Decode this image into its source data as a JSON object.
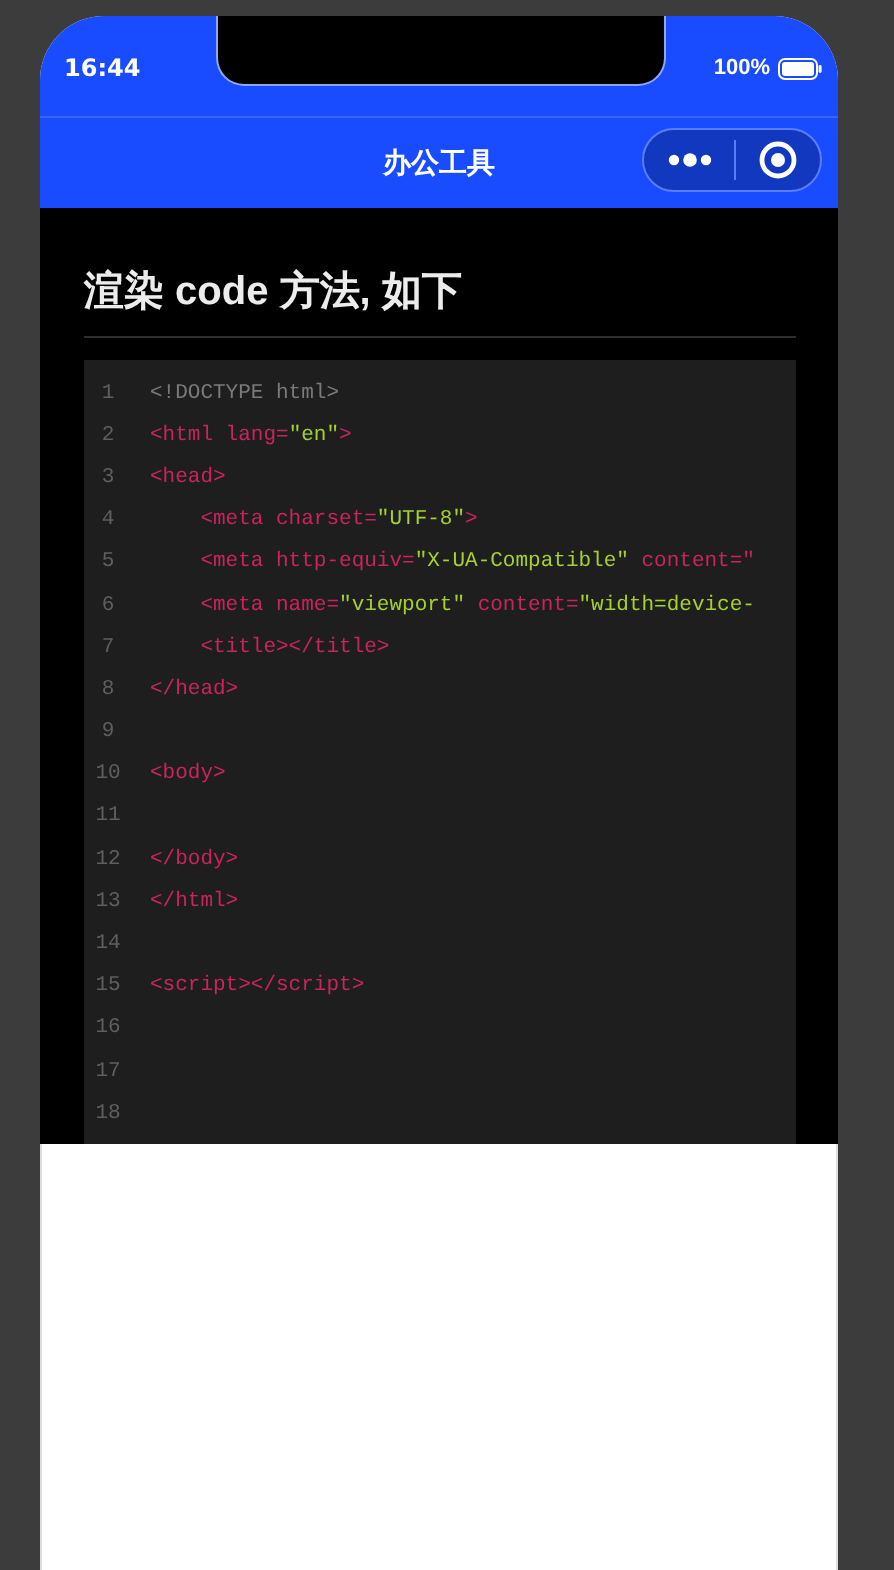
{
  "status_bar": {
    "time": "16:44",
    "battery": "100%"
  },
  "nav_bar": {
    "title": "办公工具"
  },
  "article": {
    "heading": "渲染 code 方法, 如下",
    "code_lines": [
      {
        "number": "1",
        "tokens": [
          {
            "kind": "doctype",
            "text": "<!DOCTYPE html>"
          }
        ]
      },
      {
        "number": "2",
        "tokens": [
          {
            "kind": "tag",
            "text": "<html lang="
          },
          {
            "kind": "string",
            "text": "\"en\""
          },
          {
            "kind": "tag",
            "text": ">"
          }
        ]
      },
      {
        "number": "3",
        "tokens": [
          {
            "kind": "tag",
            "text": "<head>"
          }
        ]
      },
      {
        "number": "4",
        "tokens": [
          {
            "kind": "tag",
            "text": "    <meta charset="
          },
          {
            "kind": "string",
            "text": "\"UTF-8\""
          },
          {
            "kind": "tag",
            "text": ">"
          }
        ]
      },
      {
        "number": "5",
        "tokens": [
          {
            "kind": "tag",
            "text": "    <meta http-equiv="
          },
          {
            "kind": "string",
            "text": "\"X-UA-Compatible\""
          },
          {
            "kind": "tag",
            "text": " content=\""
          }
        ]
      },
      {
        "number": "6",
        "tokens": [
          {
            "kind": "tag",
            "text": "    <meta name="
          },
          {
            "kind": "string",
            "text": "\"viewport\""
          },
          {
            "kind": "tag",
            "text": " content="
          },
          {
            "kind": "string",
            "text": "\"width=device-"
          }
        ]
      },
      {
        "number": "7",
        "tokens": [
          {
            "kind": "tag",
            "text": "    <title></title>"
          }
        ]
      },
      {
        "number": "8",
        "tokens": [
          {
            "kind": "tag",
            "text": "</head>"
          }
        ]
      },
      {
        "number": "9"
      },
      {
        "number": "10",
        "tokens": [
          {
            "kind": "tag",
            "text": "<body>"
          }
        ]
      },
      {
        "number": "11"
      },
      {
        "number": "12",
        "tokens": [
          {
            "kind": "tag",
            "text": "</body>"
          }
        ]
      },
      {
        "number": "13",
        "tokens": [
          {
            "kind": "tag",
            "text": "</html>"
          }
        ]
      },
      {
        "number": "14"
      },
      {
        "number": "15",
        "tokens": [
          {
            "kind": "tag",
            "text": "<script></script>"
          }
        ]
      },
      {
        "number": "16"
      },
      {
        "number": "17"
      },
      {
        "number": "18"
      }
    ]
  }
}
